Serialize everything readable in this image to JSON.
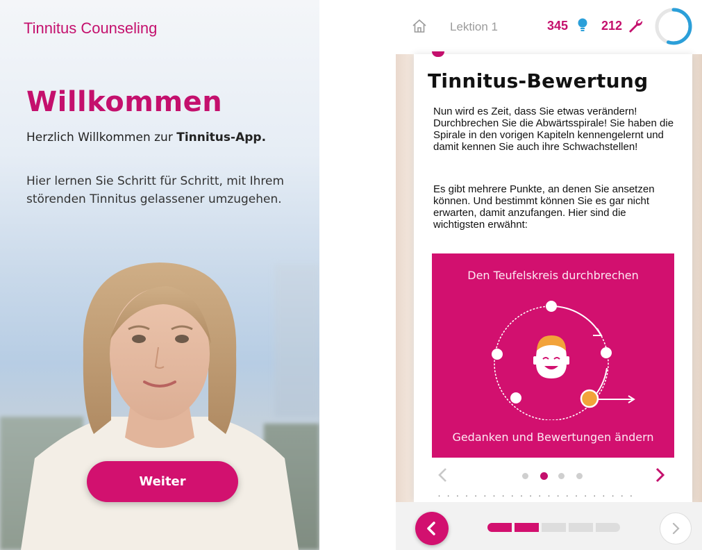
{
  "left_screen": {
    "brand": "Tinnitus Counseling",
    "title": "Willkommen",
    "greeting_prefix": "Herzlich Willkommen zur ",
    "greeting_bold": "Tinnitus-App.",
    "description": "Hier lernen Sie Schritt für Schritt, mit Ihrem störenden Tinnitus gelassener umzugehen.",
    "button_label": "Weiter"
  },
  "right_screen": {
    "header": {
      "home_icon": "home-icon",
      "lesson_label": "Lektion 1",
      "points_value": "345",
      "points_icon": "lightbulb-icon",
      "tools_value": "212",
      "tools_icon": "wrench-icon",
      "progress_fraction": 0.55
    },
    "card": {
      "title": "Tinnitus-Bewertung",
      "paragraph1": "Nun wird es Zeit, dass Sie etwas verändern! Durchbrechen Sie die Abwärtsspirale! Sie haben die Spirale in den vorigen Kapiteln kennengelernt und damit kennen Sie auch ihre Schwachstellen!",
      "paragraph2": "Es gibt mehrere Punkte, an denen Sie ansetzen können. Und bestimmt können Sie es gar nicht erwarten, damit anzufangen. Hier sind die wichtigsten erwähnt:",
      "illustration": {
        "title": "Den Teufelskreis durchbrechen",
        "subtitle": "Gedanken und Bewertungen ändern"
      },
      "carousel": {
        "slide_count": 4,
        "active_index": 1
      }
    },
    "bottom_nav": {
      "back_icon": "chevron-left-icon",
      "forward_icon": "chevron-right-icon",
      "segments_total": 5,
      "segments_completed": 2
    },
    "colors": {
      "accent": "#c4106d",
      "illustration_bg": "#d2106f",
      "highlight_node": "#f2a33a",
      "inactive": "#dddddd"
    }
  }
}
